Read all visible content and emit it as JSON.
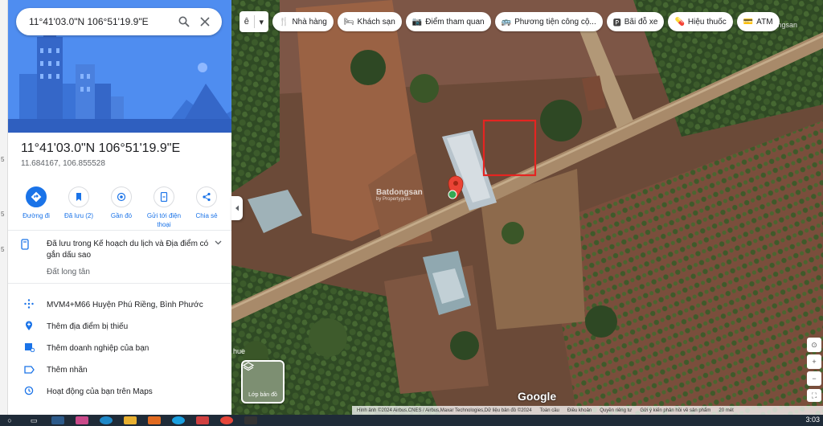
{
  "search": {
    "value": "11°41'03.0\"N 106°51'19.9\"E"
  },
  "place": {
    "title": "11°41'03.0\"N 106°51'19.9\"E",
    "decimal": "11.684167, 106.855528"
  },
  "actions": [
    {
      "label": "Đường đi",
      "icon": "directions-icon"
    },
    {
      "label": "Đã lưu (2)",
      "icon": "saved-icon"
    },
    {
      "label": "Gần đó",
      "icon": "nearby-icon"
    },
    {
      "label": "Gửi tới điện thoại",
      "icon": "send-to-phone-icon"
    },
    {
      "label": "Chia sẻ",
      "icon": "share-icon"
    }
  ],
  "saved_notice": {
    "text": "Đã lưu trong Kế hoạch du lịch và Địa điểm có gắn dấu sao",
    "sub": "Đất long tân"
  },
  "details": [
    {
      "label": "MVM4+M66 Huyện Phú Riềng, Bình Phước",
      "icon": "plus-code-icon"
    },
    {
      "label": "Thêm địa điểm bị thiếu",
      "icon": "add-place-icon"
    },
    {
      "label": "Thêm doanh nghiệp của bạn",
      "icon": "business-icon"
    },
    {
      "label": "Thêm nhãn",
      "icon": "label-icon"
    },
    {
      "label": "Hoạt động của bạn trên Maps",
      "icon": "history-icon"
    }
  ],
  "map_menu": {
    "label": "ê"
  },
  "chips": [
    {
      "label": "Nhà hàng",
      "icon": "restaurant-icon"
    },
    {
      "label": "Khách sạn",
      "icon": "hotel-icon"
    },
    {
      "label": "Điểm tham quan",
      "icon": "camera-icon"
    },
    {
      "label": "Phương tiện công cộ...",
      "icon": "transit-icon"
    },
    {
      "label": "Bãi đỗ xe",
      "icon": "parking-icon"
    },
    {
      "label": "Hiệu thuốc",
      "icon": "pharmacy-icon"
    },
    {
      "label": "ATM",
      "icon": "atm-icon"
    }
  ],
  "watermark": {
    "brand": "Batdongsan",
    "sub": "by Propertyguru"
  },
  "layer_button": {
    "label": "Lớp bản đồ"
  },
  "map_logo": "Google",
  "map_side_label": "hue",
  "attribution": {
    "imagery": "Hình ảnh ©2024 Airbus,CNES / Airbus,Maxar Technologies,Dữ liệu bản đồ ©2024",
    "links": [
      "Toàn cầu",
      "Điều khoản",
      "Quyền riêng tư",
      "Gửi ý kiến phản hồi về sản phẩm"
    ],
    "scale": "20 mét"
  },
  "edge_marks": [
    "5",
    "5",
    "5"
  ],
  "taskbar": {
    "time": "3:03"
  }
}
